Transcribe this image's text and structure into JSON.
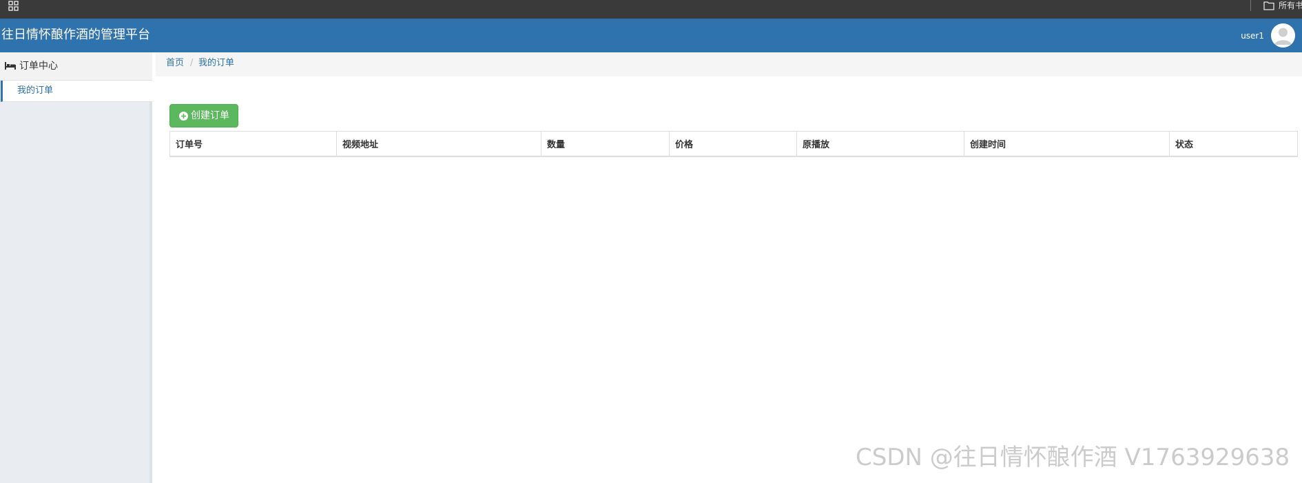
{
  "top_strip": {
    "apps_icon": "apps-grid-icon",
    "folder_icon": "folder-icon",
    "folder_label": "所有书"
  },
  "header": {
    "title": "往日情怀酿作酒的管理平台",
    "username": "user1",
    "avatar_icon": "user-avatar-icon",
    "color": "#2e72ae"
  },
  "sidebar": {
    "group": {
      "icon": "bed-icon",
      "label": "订单中心"
    },
    "items": [
      {
        "label": "我的订单",
        "active": true
      }
    ]
  },
  "breadcrumb": {
    "home": "首页",
    "separator": "/",
    "current": "我的订单"
  },
  "main": {
    "create_button": {
      "icon": "plus-circle-icon",
      "label": "创建订单",
      "color": "#5cb85c"
    },
    "table": {
      "columns": [
        "订单号",
        "视频地址",
        "数量",
        "价格",
        "原播放",
        "创建时间",
        "状态"
      ],
      "rows": []
    }
  },
  "watermark": "CSDN @往日情怀酿作酒 V1763929638"
}
